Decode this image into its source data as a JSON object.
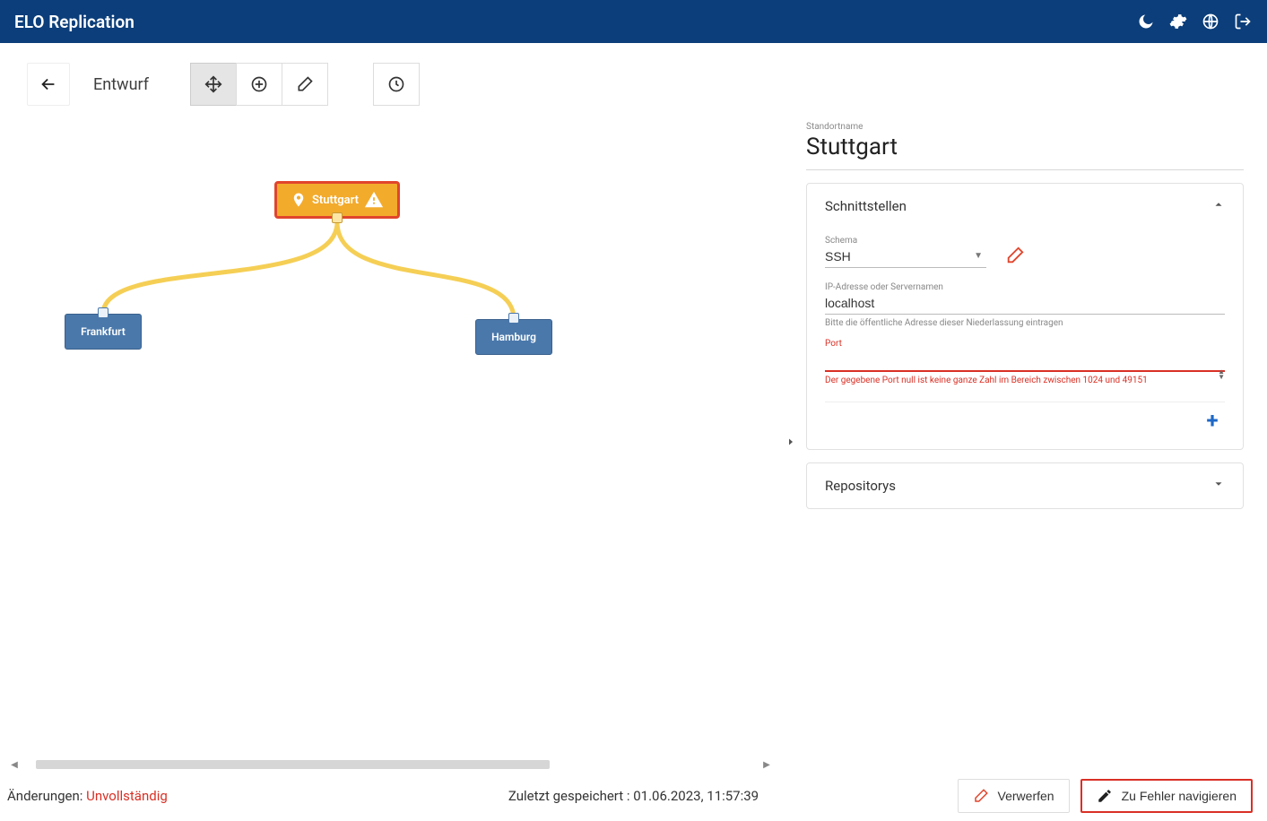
{
  "header": {
    "title": "ELO Replication"
  },
  "toolbar": {
    "draft_label": "Entwurf"
  },
  "graph": {
    "parent": {
      "label": "Stuttgart"
    },
    "child1": {
      "label": "Frankfurt"
    },
    "child2": {
      "label": "Hamburg"
    }
  },
  "panel": {
    "section_label": "Standortname",
    "title": "Stuttgart",
    "interfaces": {
      "title": "Schnittstellen",
      "schema_label": "Schema",
      "schema_value": "SSH",
      "ip_label": "IP-Adresse oder Servernamen",
      "ip_value": "localhost",
      "ip_helper": "Bitte die öffentliche Adresse dieser Niederlassung eintragen",
      "port_label": "Port",
      "port_value": "",
      "port_error": "Der gegebene Port null ist keine ganze Zahl im Bereich zwischen 1024 und 49151"
    },
    "repos_title": "Repositorys"
  },
  "footer": {
    "changes_label": "Änderungen: ",
    "changes_value": "Unvollständig",
    "saved_label": "Zuletzt gespeichert : ",
    "saved_value": "01.06.2023, 11:57:39",
    "discard_label": "Verwerfen",
    "nav_error_label": "Zu Fehler navigieren"
  }
}
